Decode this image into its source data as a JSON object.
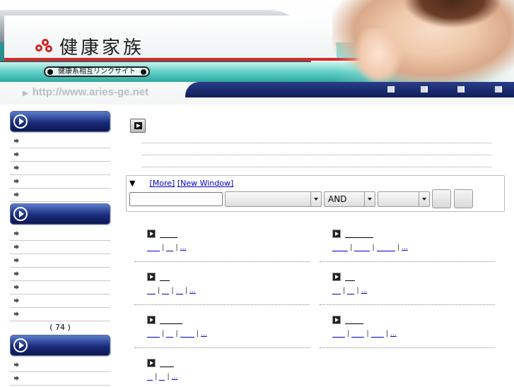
{
  "header": {
    "logo_title": "健康家族",
    "tagline": "健康系相互リンクサイト",
    "url": "http://www.aries-ge.net",
    "nav_count": 4
  },
  "sidebar": {
    "sections": [
      {
        "items": 5
      },
      {
        "items": 7,
        "count": "(   74   )"
      },
      {
        "items": 2
      }
    ]
  },
  "search": {
    "toggle": "▼",
    "more_link": "[More]",
    "new_window_link": "[New Window]",
    "input_value": "",
    "operator": "AND"
  },
  "entries": [
    {
      "link_count": 2
    },
    {
      "link_count": 3
    },
    {
      "link_count": 3
    },
    {
      "link_count": 2
    },
    {
      "link_count": 3
    },
    {
      "link_count": 3
    },
    {
      "link_count": 2
    }
  ],
  "more_label": "...",
  "colors": {
    "brand_red": "#d42a2a",
    "teal": "#3cc0b8",
    "navy": "#101d5a",
    "link": "#0000cc"
  }
}
